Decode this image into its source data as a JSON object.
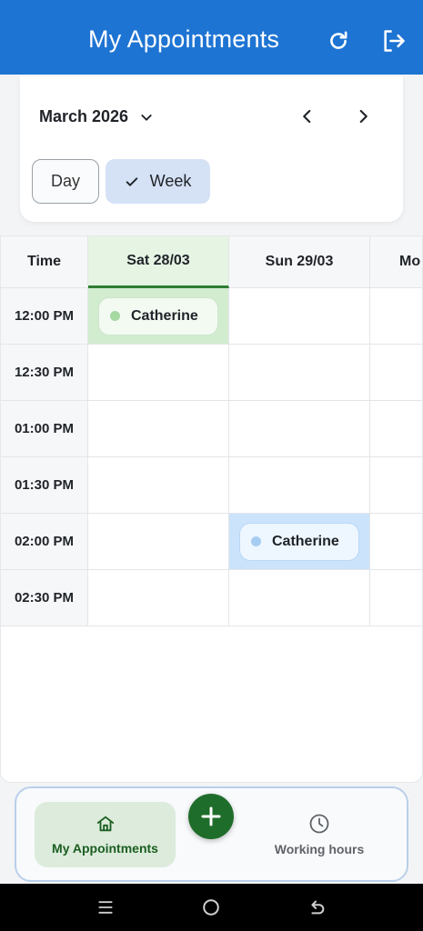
{
  "app_bar": {
    "title": "My Appointments",
    "refresh_icon": "refresh-icon",
    "logout_icon": "logout-icon",
    "color": "#1e74d3"
  },
  "calendar_header": {
    "month": "March 2026",
    "views": {
      "day": "Day",
      "week": "Week",
      "selected": "Week"
    }
  },
  "calendar": {
    "time_header": "Time",
    "days": [
      "Sat  28/03",
      "Sun  29/03",
      "Mo"
    ],
    "times": [
      "12:00 PM",
      "12:30 PM",
      "01:00 PM",
      "01:30 PM",
      "02:00 PM",
      "02:30 PM"
    ],
    "events": [
      {
        "name": "Catherine",
        "day": "Sat  28/03",
        "time": "12:00 PM",
        "color": "#a6d8a2"
      },
      {
        "name": "Catherine",
        "day": "Sun  29/03",
        "time": "02:00 PM",
        "color": "#a8cdf3"
      }
    ]
  },
  "bottom_nav": {
    "items": [
      {
        "label": "My Appointments",
        "icon": "home-icon",
        "active": true
      },
      {
        "label": "Working hours",
        "icon": "clock-icon",
        "active": false
      }
    ],
    "fab_icon": "plus-icon",
    "accent": "#1f6d2a"
  }
}
